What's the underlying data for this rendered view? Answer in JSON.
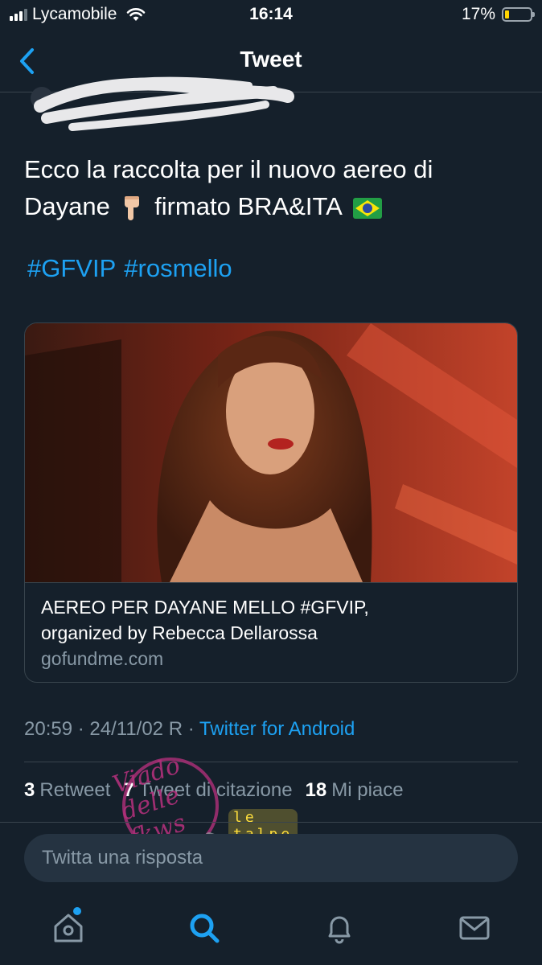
{
  "status": {
    "carrier": "Lycamobile",
    "time": "16:14",
    "battery": "17%",
    "battery_level": 0.17,
    "icons": [
      "signal-icon",
      "wifi-icon",
      "battery-icon"
    ]
  },
  "nav": {
    "title": "Tweet",
    "back_icon": "chevron-left-icon"
  },
  "tweet": {
    "text_line1": "Ecco la raccolta per il nuovo aereo di",
    "text_line2_a": "Dayane",
    "text_line2_b": "firmato BRA&ITA",
    "emoji": [
      "pointing-down-hand",
      "brazil-flag"
    ],
    "hashtags": [
      "#GFVIP",
      "#rosmello"
    ]
  },
  "card": {
    "title_line1": "AEREO PER DAYANE MELLO #GFVIP,",
    "title_line2": "organized by Rebecca Dellarossa",
    "domain": "gofundme.com"
  },
  "meta": {
    "timestamp": "20:59 · 24/11/02 R ·",
    "source": "Twitter for Android"
  },
  "stats": {
    "retweets_count": "3",
    "retweets_label": "Retweet",
    "quotes_count": "7",
    "quotes_label": "Tweet di citazione",
    "likes_count": "18",
    "likes_label": "Mi piace"
  },
  "reply": {
    "placeholder": "Twitta una risposta"
  },
  "tabbar": {
    "icons": [
      "home-icon",
      "search-icon",
      "notifications-icon",
      "messages-icon"
    ],
    "active": "search-icon"
  },
  "watermark": {
    "banner": "le talpe del web",
    "logo": "Viado delle fkws"
  },
  "colors": {
    "background": "#15202b",
    "accent": "#1da1f2",
    "muted": "#8899a6",
    "border": "#38444d"
  }
}
